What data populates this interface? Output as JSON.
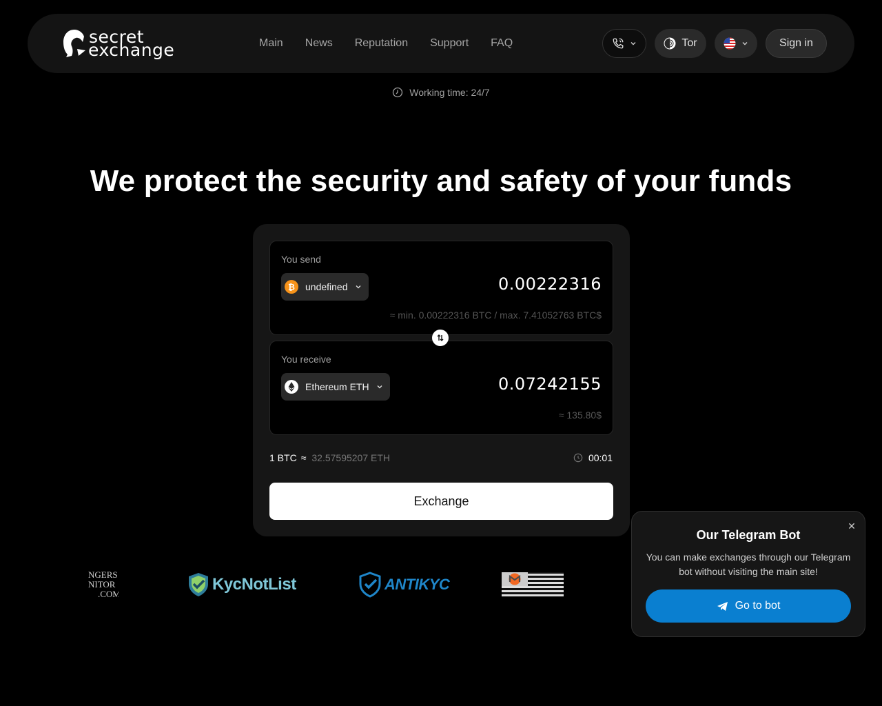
{
  "header": {
    "logo_line1": "secret",
    "logo_line2": "exchange",
    "nav": [
      {
        "label": "Main"
      },
      {
        "label": "News"
      },
      {
        "label": "Reputation"
      },
      {
        "label": "Support"
      },
      {
        "label": "FAQ"
      }
    ],
    "tor_label": "Tor",
    "signin_label": "Sign in",
    "language_icon": "us-flag-icon"
  },
  "working_time": "Working time: 24/7",
  "hero_title": "We protect the security and safety of your funds",
  "exchange": {
    "send": {
      "label": "You send",
      "currency": "undefined",
      "currency_icon": "bitcoin-icon",
      "amount": "0.00222316",
      "hint": "≈ min. 0.00222316 BTC / max. 7.41052763 BTC$"
    },
    "receive": {
      "label": "You receive",
      "currency": "Ethereum ETH",
      "currency_icon": "ethereum-icon",
      "amount": "0.07242155",
      "hint": "≈ 135.80$"
    },
    "rate_base": "1 BTC",
    "rate_approx": "≈",
    "rate_value": "32.57595207 ETH",
    "timer": "00:01",
    "button_label": "Exchange"
  },
  "partners": {
    "dangers_lines": [
      "NGERS",
      "NITOR",
      ".COM"
    ],
    "kyc_label": "KycNotList",
    "antikyc_label": "ANTIKYC",
    "monero_icon": "monero-flag-icon"
  },
  "telegram": {
    "title": "Our Telegram Bot",
    "text": "You can make exchanges through our Telegram bot without visiting the main site!",
    "button_label": "Go to bot"
  },
  "colors": {
    "background": "#000000",
    "panel": "#161616",
    "accent_blue": "#0a7fd0",
    "bitcoin_orange": "#f7931a"
  }
}
